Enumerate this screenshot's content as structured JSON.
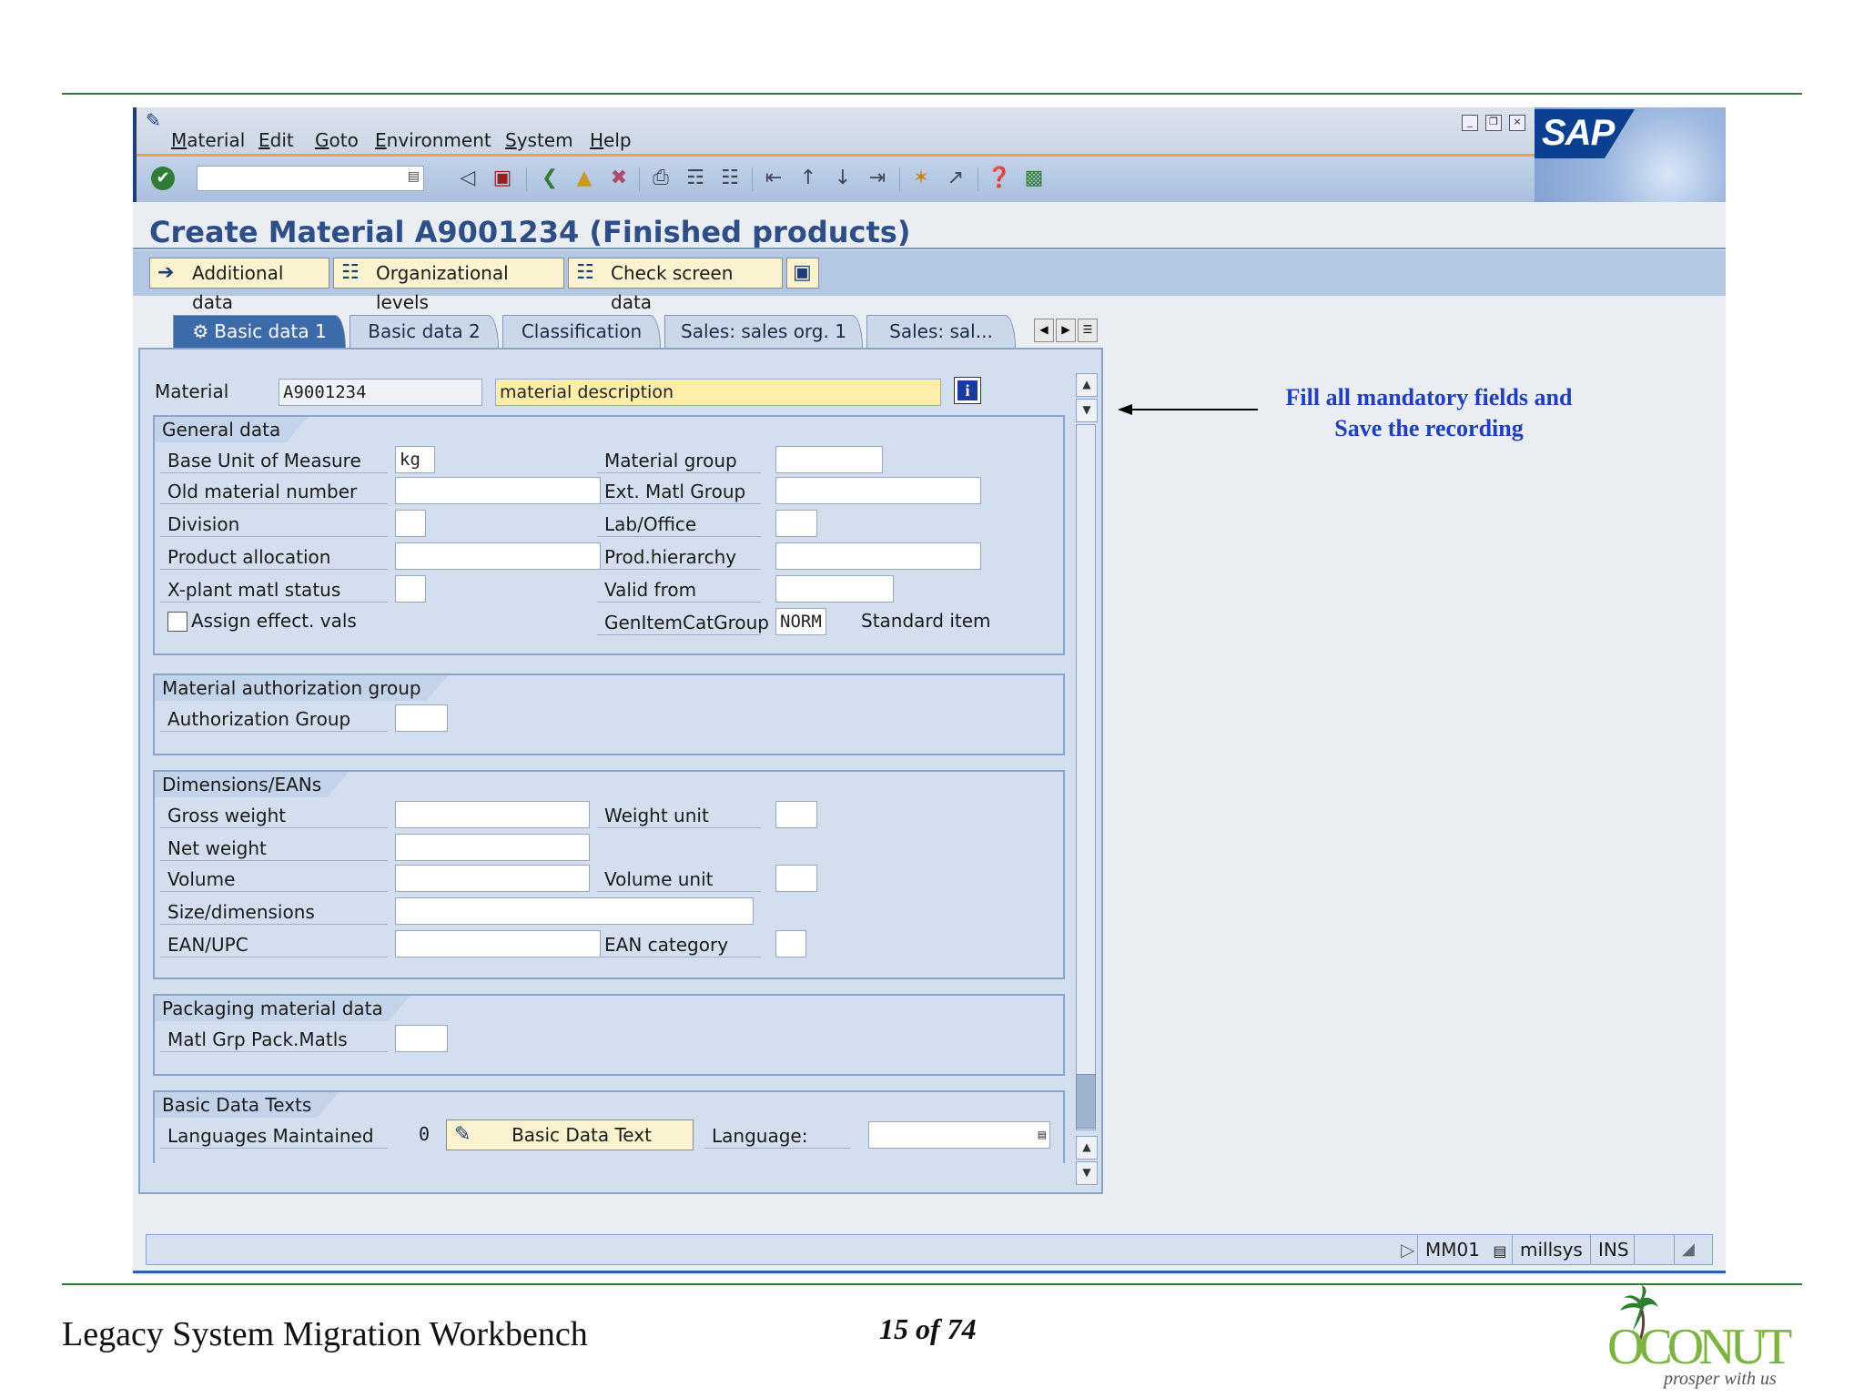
{
  "menu": [
    "Material",
    "Edit",
    "Goto",
    "Environment",
    "System",
    "Help"
  ],
  "logo_text": "SAP",
  "page_title": "Create Material A9001234 (Finished products)",
  "app_toolbar": {
    "additional_data": "Additional data",
    "org_levels": "Organizational levels",
    "check_screen": "Check screen data"
  },
  "tabs": [
    "Basic data 1",
    "Basic data 2",
    "Classification",
    "Sales: sales org. 1",
    "Sales: sal..."
  ],
  "material": {
    "label": "Material",
    "number": "A9001234",
    "description": "material description"
  },
  "general_data": {
    "title": "General data",
    "base_uom_label": "Base Unit of Measure",
    "base_uom_value": "kg",
    "old_material_label": "Old material number",
    "division_label": "Division",
    "product_allocation_label": "Product allocation",
    "xplant_label": "X-plant matl status",
    "assign_effect_label": "Assign effect. vals",
    "material_group_label": "Material group",
    "ext_matl_group_label": "Ext. Matl Group",
    "lab_office_label": "Lab/Office",
    "prod_hierarchy_label": "Prod.hierarchy",
    "valid_from_label": "Valid from",
    "gen_item_cat_label": "GenItemCatGroup",
    "gen_item_cat_value": "NORM",
    "gen_item_cat_desc": "Standard item"
  },
  "auth_group": {
    "title": "Material authorization group",
    "label": "Authorization Group"
  },
  "dimensions": {
    "title": "Dimensions/EANs",
    "gross_weight": "Gross weight",
    "net_weight": "Net weight",
    "volume": "Volume",
    "size_dimensions": "Size/dimensions",
    "ean_upc": "EAN/UPC",
    "weight_unit": "Weight unit",
    "volume_unit": "Volume unit",
    "ean_category": "EAN category"
  },
  "packaging": {
    "title": "Packaging material data",
    "label": "Matl Grp Pack.Matls"
  },
  "basic_texts": {
    "title": "Basic Data Texts",
    "languages_label": "Languages Maintained",
    "languages_count": "0",
    "button": "Basic Data Text",
    "language_label": "Language:"
  },
  "status": {
    "transaction": "MM01",
    "system": "millsys",
    "mode": "INS"
  },
  "annotation": {
    "line1": "Fill all mandatory fields and",
    "line2": "Save the recording"
  },
  "footer": {
    "title": "Legacy System Migration Workbench",
    "page": "15 of 74",
    "brand": "OCONUT",
    "tagline": "prosper with us"
  },
  "colors": {
    "rule_green": "#2e7d32",
    "title_blue": "#2d4e86",
    "required_yellow": "#fdefa9",
    "annotation_blue": "#1f3fbf"
  }
}
